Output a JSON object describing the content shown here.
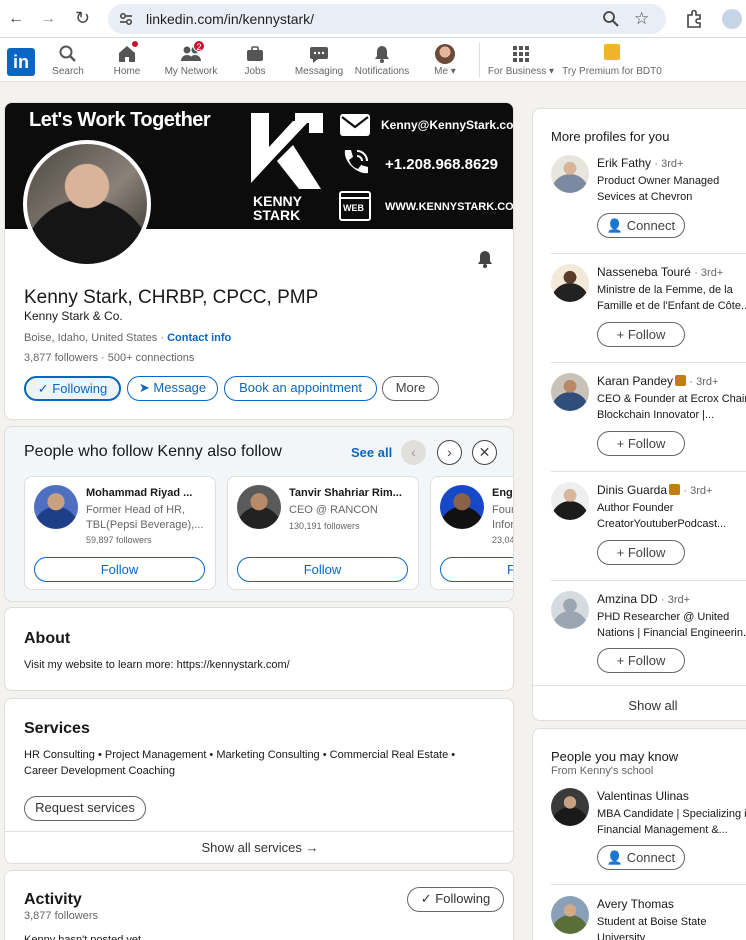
{
  "browser": {
    "url": "linkedin.com/in/kennystark/",
    "back_icon": "←",
    "forward_icon": "→",
    "reload_icon": "↻",
    "star_icon": "☆"
  },
  "nav": {
    "logo": "in",
    "items": [
      {
        "label": "Search",
        "icon": "search-icon"
      },
      {
        "label": "Home",
        "icon": "home-icon"
      },
      {
        "label": "My Network",
        "icon": "people-icon",
        "badge": "2"
      },
      {
        "label": "Jobs",
        "icon": "briefcase-icon"
      },
      {
        "label": "Messaging",
        "icon": "chat-icon"
      },
      {
        "label": "Notifications",
        "icon": "bell-icon"
      },
      {
        "label": "Me ▾",
        "icon": "avatar"
      },
      {
        "label": "For Business ▾",
        "icon": "grid-icon"
      },
      {
        "label": "Try Premium for BDT0",
        "icon": "premium-icon"
      }
    ]
  },
  "banner": {
    "headline": "Let's Work Together",
    "brand_line1": "KENNY",
    "brand_line2": "STARK",
    "email": "Kenny@KennyStark.com",
    "phone": "+1.208.968.8629",
    "web_label": "WEB",
    "website": "WWW.KENNYSTARK.COM"
  },
  "profile": {
    "name": "Kenny Stark, CHRBP, CPCC, PMP",
    "company": "Kenny Stark & Co.",
    "location": "Boise, Idaho, United States",
    "contact_info": "Contact info",
    "followers": "3,877 followers",
    "connections": "500+ connections",
    "following_btn": "✓ Following",
    "message_btn": "Message",
    "book_btn": "Book an appointment",
    "more_btn": "More"
  },
  "also_follow": {
    "title": "People who follow Kenny also follow",
    "see_all": "See all",
    "cards": [
      {
        "name": "Mohammad Riyad ...",
        "line1": "Former Head of HR,",
        "line2": "TBL(Pepsi Beverage),...",
        "followers": "59,897 followers",
        "follow": "Follow"
      },
      {
        "name": "Tanvir Shahriar Rim...",
        "line1": "CEO @ RANCON",
        "line2": "",
        "followers": "130,191 followers",
        "follow": "Follow"
      },
      {
        "name": "Engr",
        "line1": "Foun",
        "line2": "Infor",
        "followers": "23,04",
        "follow": "F"
      }
    ]
  },
  "about": {
    "title": "About",
    "text": "Visit my website to learn more: https://kennystark.com/"
  },
  "services": {
    "title": "Services",
    "line1": "HR Consulting • Project Management • Marketing Consulting • Commercial Real Estate •",
    "line2": "Career Development Coaching",
    "request_btn": "Request services",
    "show_all": "Show all services →"
  },
  "activity": {
    "title": "Activity",
    "followers": "3,877 followers",
    "following_btn": "✓ Following",
    "cut_text": "Kenny hasn't posted yet"
  },
  "more_profiles": {
    "title": "More profiles for you",
    "items": [
      {
        "name": "Erik Fathy",
        "degree": "· 3rd+",
        "desc1": "Product Owner Managed",
        "desc2": "Sevices at Chevron",
        "btn": "Connect"
      },
      {
        "name": "Nasseneba Touré",
        "degree": "· 3rd+",
        "desc1": " Ministre de la Femme, de la",
        "desc2": "Famille et de l'Enfant de Côte...",
        "btn": "Follow"
      },
      {
        "name": "Karan Pandey",
        "degree": "· 3rd+",
        "desc1": "CEO & Founder at Ecrox Chain",
        "desc2": "Blockchain Innovator |...",
        "btn": "Follow"
      },
      {
        "name": "Dinis Guarda",
        "degree": "· 3rd+",
        "desc1": "Author Founder",
        "desc2": "CreatorYoutuberPodcast...",
        "btn": "Follow"
      },
      {
        "name": "Amzina DD",
        "degree": "· 3rd+",
        "desc1": "PHD Researcher @ United",
        "desc2": "Nations | Financial Engineerin...",
        "btn": "Follow"
      }
    ],
    "show_all": "Show all"
  },
  "people_know": {
    "title": "People you may know",
    "subtitle": "From Kenny's school",
    "items": [
      {
        "name": "Valentinas Ulinas",
        "desc1": "MBA Candidate | Specializing i",
        "desc2": "Financial Management &...",
        "btn": "Connect"
      },
      {
        "name": "Avery Thomas",
        "desc1": "Student at Boise State",
        "desc2": "University"
      }
    ]
  },
  "colors": {
    "brand": "#0a66c2",
    "bg": "#f4f2ee",
    "badge": "#cb112d",
    "premium": "#c37d16"
  }
}
